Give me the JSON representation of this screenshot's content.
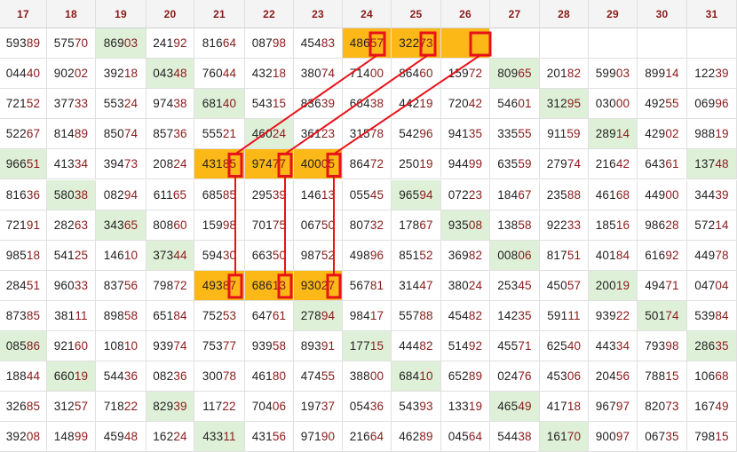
{
  "headers": [
    "17",
    "18",
    "19",
    "20",
    "21",
    "22",
    "23",
    "24",
    "25",
    "26",
    "27",
    "28",
    "29",
    "30",
    "31"
  ],
  "rows": [
    [
      "59389",
      "57570",
      "86903",
      "24192",
      "81664",
      "08798",
      "45483",
      "48657",
      "32273",
      "",
      "",
      "",
      "",
      "",
      ""
    ],
    [
      "04440",
      "90202",
      "39218",
      "04348",
      "76044",
      "43218",
      "38074",
      "71400",
      "86460",
      "15972",
      "80965",
      "20182",
      "59903",
      "89914",
      "12239"
    ],
    [
      "72152",
      "37733",
      "55324",
      "97438",
      "68140",
      "54315",
      "83639",
      "66438",
      "44219",
      "72042",
      "54601",
      "31295",
      "03000",
      "49255",
      "06996"
    ],
    [
      "52267",
      "81489",
      "85074",
      "85736",
      "55521",
      "46024",
      "36123",
      "31578",
      "54296",
      "94135",
      "33555",
      "91159",
      "28914",
      "42902",
      "98819"
    ],
    [
      "96651",
      "41334",
      "39473",
      "20824",
      "43185",
      "97477",
      "40005",
      "86472",
      "25019",
      "94499",
      "63559",
      "27974",
      "21642",
      "64361",
      "13748"
    ],
    [
      "81636",
      "58038",
      "08294",
      "61165",
      "68585",
      "29539",
      "14613",
      "05545",
      "96594",
      "07223",
      "18467",
      "23588",
      "46168",
      "44900",
      "34439"
    ],
    [
      "72191",
      "28263",
      "34365",
      "80860",
      "15998",
      "70175",
      "06750",
      "80732",
      "17867",
      "93508",
      "13858",
      "92233",
      "18516",
      "98628",
      "57214"
    ],
    [
      "98518",
      "54125",
      "14610",
      "37344",
      "59430",
      "66350",
      "98752",
      "49896",
      "85152",
      "36982",
      "00806",
      "81751",
      "40184",
      "61692",
      "44978"
    ],
    [
      "28451",
      "96033",
      "83756",
      "79872",
      "49387",
      "68613",
      "93027",
      "56781",
      "31447",
      "38024",
      "25345",
      "45057",
      "20019",
      "49471",
      "04704"
    ],
    [
      "87385",
      "38111",
      "89858",
      "65184",
      "75253",
      "64761",
      "27894",
      "98417",
      "55788",
      "45482",
      "14235",
      "59111",
      "93922",
      "50174",
      "53984"
    ],
    [
      "08586",
      "92160",
      "10810",
      "93974",
      "75377",
      "93958",
      "89391",
      "17715",
      "44482",
      "51492",
      "45571",
      "62540",
      "44334",
      "79398",
      "28635"
    ],
    [
      "18844",
      "66019",
      "54436",
      "08236",
      "30078",
      "46180",
      "47455",
      "38800",
      "68410",
      "65289",
      "02476",
      "45306",
      "20456",
      "78815",
      "10668"
    ],
    [
      "32685",
      "31257",
      "71822",
      "82939",
      "11722",
      "70406",
      "19737",
      "05436",
      "54393",
      "13319",
      "46549",
      "41718",
      "96797",
      "82073",
      "16749"
    ],
    [
      "39208",
      "14899",
      "45948",
      "16224",
      "43311",
      "43156",
      "97190",
      "21664",
      "46289",
      "04564",
      "54438",
      "16170",
      "90097",
      "06735",
      "79815"
    ]
  ],
  "green_cells": [
    [
      0,
      2
    ],
    [
      1,
      3
    ],
    [
      1,
      10
    ],
    [
      2,
      4
    ],
    [
      2,
      11
    ],
    [
      3,
      5
    ],
    [
      3,
      12
    ],
    [
      4,
      0
    ],
    [
      4,
      14
    ],
    [
      5,
      1
    ],
    [
      5,
      8
    ],
    [
      6,
      2
    ],
    [
      6,
      9
    ],
    [
      7,
      3
    ],
    [
      7,
      10
    ],
    [
      8,
      12
    ],
    [
      9,
      6
    ],
    [
      9,
      13
    ],
    [
      10,
      0
    ],
    [
      10,
      7
    ],
    [
      10,
      14
    ],
    [
      11,
      1
    ],
    [
      11,
      8
    ],
    [
      12,
      3
    ],
    [
      12,
      10
    ],
    [
      13,
      4
    ],
    [
      13,
      11
    ]
  ],
  "orange_cells": [
    [
      0,
      7
    ],
    [
      0,
      8
    ],
    [
      0,
      9
    ],
    [
      4,
      4
    ],
    [
      4,
      5
    ],
    [
      4,
      6
    ],
    [
      8,
      4
    ],
    [
      8,
      5
    ],
    [
      8,
      6
    ]
  ],
  "colors": {
    "header_text": "#8b1a1a",
    "tail_digits": "#8b1a1a",
    "green": "#dff0d8",
    "orange": "#fbb817",
    "highlight_box": "#e8121a"
  }
}
